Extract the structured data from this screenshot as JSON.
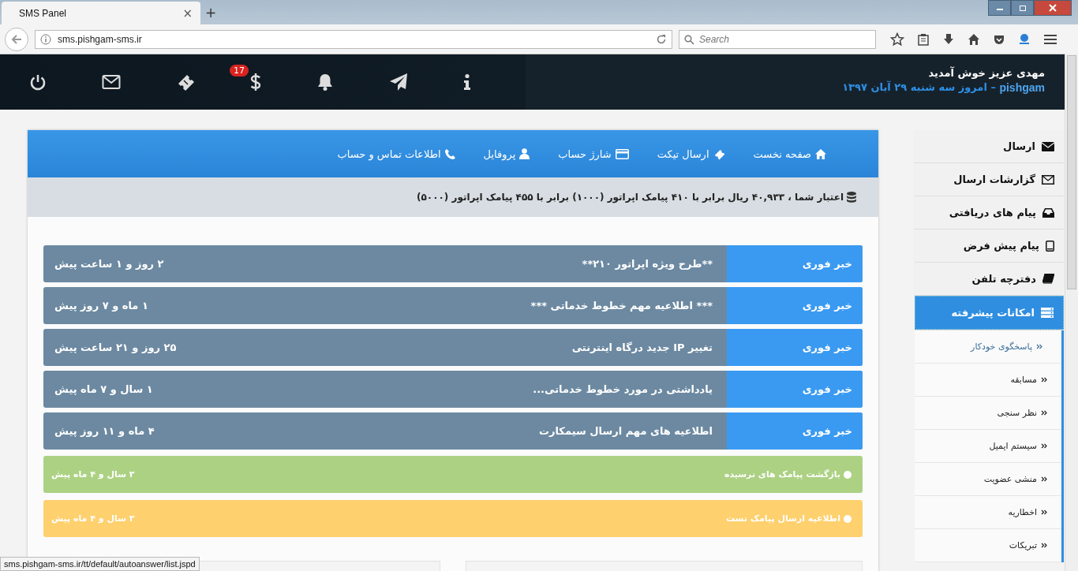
{
  "browser": {
    "tab_title": "SMS Panel",
    "tab_close": "×",
    "new_tab": "+",
    "address": "sms.pishgam-sms.ir",
    "search": {
      "placeholder": "Search"
    },
    "status_url": "sms.pishgam-sms.ir/tt/default/autoanswer/list.jspd"
  },
  "header": {
    "welcome": "مهدی عزیز خوش آمدید",
    "brand": "pishgam",
    "date": " – امروز سه شنبه ۲۹ آبان ۱۳۹۷",
    "badge": "17"
  },
  "top_nav": [
    {
      "label": "صفحه نخست"
    },
    {
      "label": "ارسال تیکت"
    },
    {
      "label": "شارژ حساب"
    },
    {
      "label": "پروفایل"
    },
    {
      "label": "اطلاعات تماس و حساب"
    }
  ],
  "credit": "اعتبار شما ، ۴۰,۹۳۳ ریال برابر با ۴۱۰ پیامک اپراتور (۱۰۰۰) برابر با ۴۵۵ پیامک اپراتور (۵۰۰۰)",
  "news": [
    {
      "tag": "خبر فوری",
      "title": "**طرح ویژه اپراتور ۲۱۰**",
      "time": "۲ روز و ۱ ساعت پیش"
    },
    {
      "tag": "خبر فوری",
      "title": "*** اطلاعیه مهم خطوط خدماتی ***",
      "time": "۱ ماه و ۷ روز پیش"
    },
    {
      "tag": "خبر فوری",
      "title": "تغییر IP جدید درگاه اینترنتی",
      "time": "۲۵ روز و ۲۱ ساعت پیش"
    },
    {
      "tag": "خبر فوری",
      "title": "یادداشتی در مورد خطوط خدماتی...",
      "time": "۱ سال و ۷ ماه پیش"
    },
    {
      "tag": "خبر فوری",
      "title": "اطلاعیه های مهم ارسال سیمکارت",
      "time": "۴ ماه و ۱۱ روز پیش"
    }
  ],
  "alerts": [
    {
      "title": "بازگشت پیامک های نرسیده",
      "time": "۳ سال و ۴ ماه پیش",
      "color": "#acd183"
    },
    {
      "title": "اطلاعیه ارسال پیامک تست",
      "time": "۳ سال و ۴ ماه پیش",
      "color": "#fed06e"
    }
  ],
  "sidebar": {
    "items": [
      {
        "label": "ارسال",
        "selected": false
      },
      {
        "label": "گزارشات ارسال",
        "selected": false
      },
      {
        "label": "پیام های دریافتی",
        "selected": false
      },
      {
        "label": "پیام پیش فرض",
        "selected": false
      },
      {
        "label": "دفترچه تلفن",
        "selected": false
      },
      {
        "label": "امکانات پیشرفته",
        "selected": true
      }
    ],
    "sub_items": [
      {
        "label": "پاسخگوی خودکار",
        "selected": true
      },
      {
        "label": "مسابقه",
        "selected": false
      },
      {
        "label": "نظر سنجی",
        "selected": false
      },
      {
        "label": "سیستم ایمیل",
        "selected": false
      },
      {
        "label": "منشی عضویت",
        "selected": false
      },
      {
        "label": "اخطاریه",
        "selected": false
      },
      {
        "label": "تبریکات",
        "selected": false
      }
    ]
  }
}
